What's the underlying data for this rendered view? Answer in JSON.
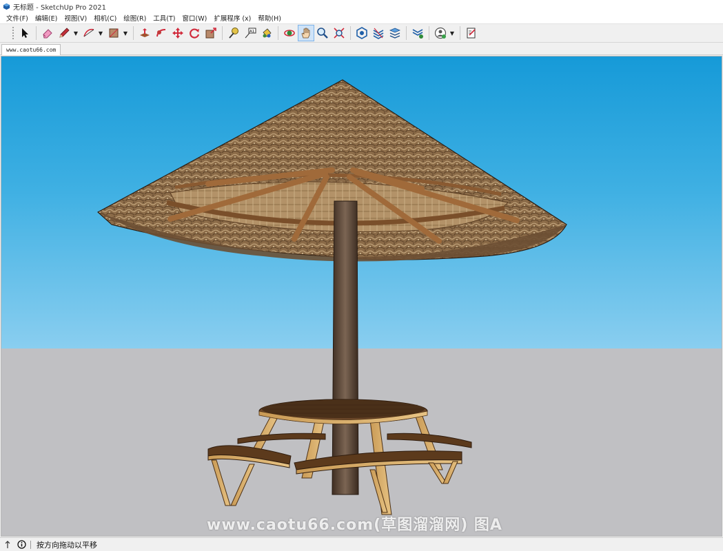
{
  "window": {
    "title": "无标题 - SketchUp Pro 2021"
  },
  "menu": [
    {
      "label": "文件(F)"
    },
    {
      "label": "编辑(E)"
    },
    {
      "label": "视图(V)"
    },
    {
      "label": "相机(C)"
    },
    {
      "label": "绘图(R)"
    },
    {
      "label": "工具(T)"
    },
    {
      "label": "窗口(W)"
    },
    {
      "label": "扩展程序 (x)"
    },
    {
      "label": "帮助(H)"
    }
  ],
  "toolbar": {
    "tools": [
      {
        "name": "select-tool",
        "icon": "arrow-cursor-icon"
      },
      {
        "name": "eraser-tool",
        "icon": "eraser-icon"
      },
      {
        "name": "line-tool",
        "icon": "pencil-icon"
      },
      {
        "name": "arc-tool",
        "icon": "arc-icon"
      },
      {
        "name": "rectangle-tool",
        "icon": "rectangle-icon"
      },
      {
        "name": "push-pull-tool",
        "icon": "push-pull-icon"
      },
      {
        "name": "follow-me-tool",
        "icon": "follow-me-icon"
      },
      {
        "name": "move-tool",
        "icon": "move-icon"
      },
      {
        "name": "rotate-tool",
        "icon": "rotate-icon"
      },
      {
        "name": "scale-tool",
        "icon": "scale-icon"
      },
      {
        "name": "tape-measure-tool",
        "icon": "tape-measure-icon"
      },
      {
        "name": "text-tool",
        "icon": "text-label-icon"
      },
      {
        "name": "paint-bucket-tool",
        "icon": "paint-bucket-icon"
      },
      {
        "name": "orbit-tool",
        "icon": "orbit-icon"
      },
      {
        "name": "pan-tool",
        "icon": "hand-icon"
      },
      {
        "name": "zoom-tool",
        "icon": "magnifier-icon"
      },
      {
        "name": "zoom-extents-tool",
        "icon": "zoom-extents-icon"
      },
      {
        "name": "warehouse-tool",
        "icon": "warehouse-icon"
      },
      {
        "name": "extension-warehouse-tool",
        "icon": "extension-warehouse-icon"
      },
      {
        "name": "layout-tool",
        "icon": "layers-icon"
      },
      {
        "name": "trimble-connect-tool",
        "icon": "connect-icon"
      },
      {
        "name": "account-tool",
        "icon": "account-icon"
      },
      {
        "name": "send-to-layout-tool",
        "icon": "layout-send-icon"
      }
    ],
    "active_tool": "pan-tool"
  },
  "scene_tab": {
    "label": "www.caotu66.com"
  },
  "viewport": {
    "watermark": "www.caotu66.com(草图溜溜网) 图A",
    "sky_top": "#169ad8",
    "sky_bottom": "#c4e6f7",
    "ground": "#c0c0c3"
  },
  "status": {
    "text": "按方向拖动以平移"
  }
}
